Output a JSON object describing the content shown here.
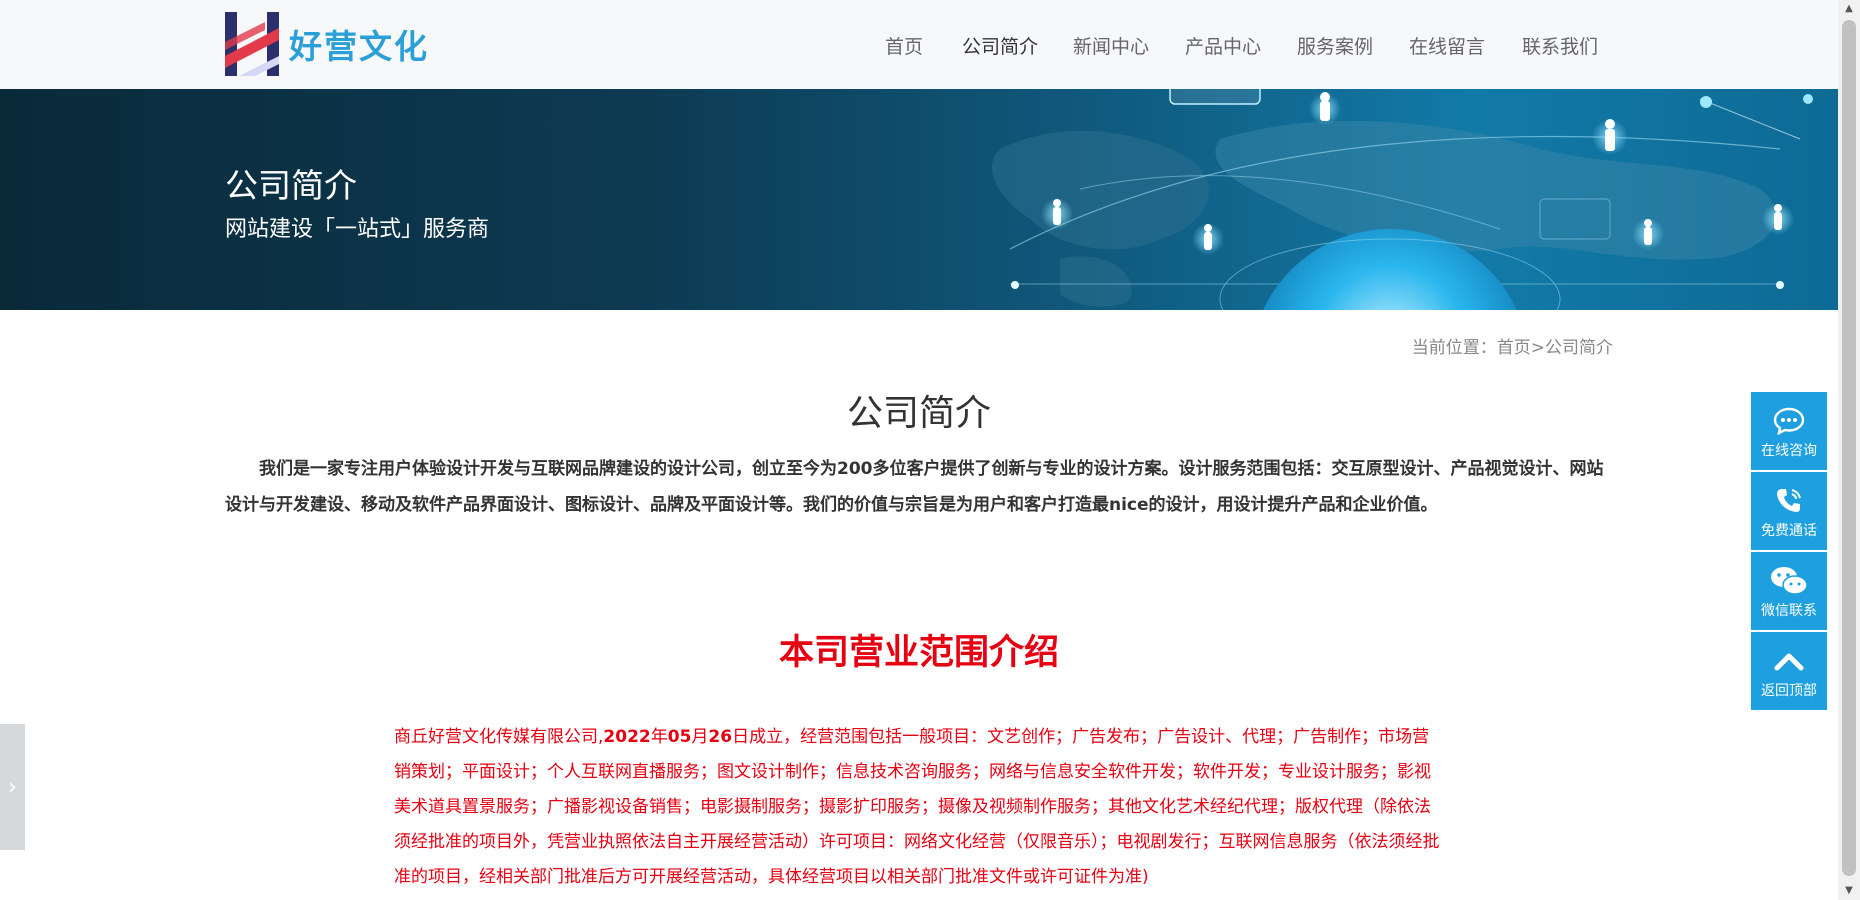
{
  "header": {
    "logo_text": "好营文化",
    "nav": [
      {
        "label": "首页",
        "active": false
      },
      {
        "label": "公司简介",
        "active": true
      },
      {
        "label": "新闻中心",
        "active": false
      },
      {
        "label": "产品中心",
        "active": false
      },
      {
        "label": "服务案例",
        "active": false
      },
      {
        "label": "在线留言",
        "active": false
      },
      {
        "label": "联系我们",
        "active": false
      }
    ]
  },
  "banner": {
    "title": "公司简介",
    "subtitle": "网站建设「一站式」服务商"
  },
  "breadcrumb": {
    "text": "当前位置：首页>公司简介"
  },
  "main": {
    "title": "公司简介",
    "intro": "我们是一家专注用户体验设计开发与互联网品牌建设的设计公司，创立至今为200多位客户提供了创新与专业的设计方案。设计服务范围包括：交互原型设计、产品视觉设计、网站设计与开发建设、移动及软件产品界面设计、图标设计、品牌及平面设计等。我们的价值与宗旨是为用户和客户打造最nice的设计，用设计提升产品和企业价值。",
    "scope_title": "本司营业范围介绍",
    "scope_company": "商丘好营文化传媒有限公司,",
    "scope_year": "2022",
    "scope_year_unit": "年",
    "scope_month": "05",
    "scope_month_unit": "月",
    "scope_day": "26",
    "scope_rest": "日成立，经营范围包括一般项目：文艺创作；广告发布；广告设计、代理；广告制作；市场营销策划；平面设计；个人互联网直播服务；图文设计制作；信息技术咨询服务；网络与信息安全软件开发；软件开发；专业设计服务；影视美术道具置景服务；广播影视设备销售；电影摄制服务；摄影扩印服务；摄像及视频制作服务；其他文化艺术经纪代理；版权代理（除依法须经批准的项目外，凭营业执照依法自主开展经营活动）许可项目：网络文化经营（仅限音乐）；电视剧发行；互联网信息服务（依法须经批准的项目，经相关部门批准后方可开展经营活动，具体经营项目以相关部门批准文件或许可证件为准)"
  },
  "float_bar": [
    {
      "label": "在线咨询",
      "icon": "chat-bubble-icon"
    },
    {
      "label": "免费通话",
      "icon": "phone-icon"
    },
    {
      "label": "微信联系",
      "icon": "wechat-icon"
    },
    {
      "label": "返回顶部",
      "icon": "chevron-up-icon"
    }
  ],
  "colors": {
    "accent": "#1ea0e0",
    "red": "#e60012",
    "logo_blue": "#2a9fd8"
  }
}
